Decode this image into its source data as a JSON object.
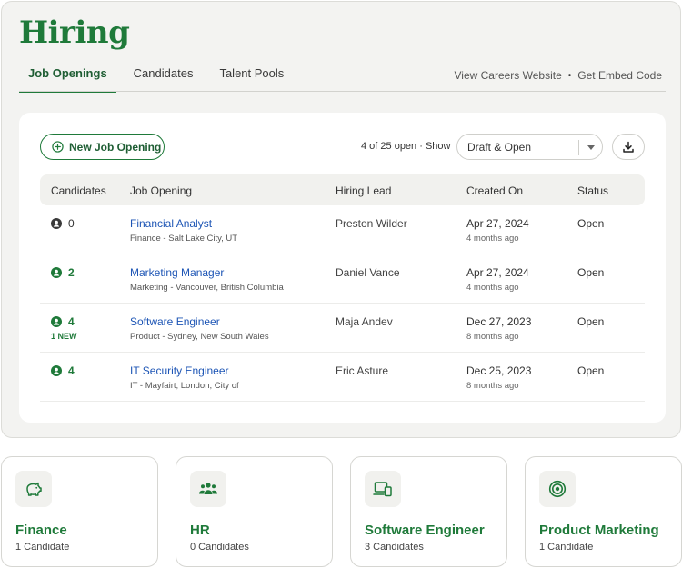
{
  "header": {
    "title": "Hiring"
  },
  "tabs": [
    {
      "label": "Job Openings",
      "active": true
    },
    {
      "label": "Candidates",
      "active": false
    },
    {
      "label": "Talent Pools",
      "active": false
    }
  ],
  "top_links": {
    "careers": "View Careers Website",
    "separator": "•",
    "embed": "Get Embed Code"
  },
  "toolbar": {
    "new_button": "New Job Opening",
    "open_count": "4 of 25 open · Show",
    "filter_value": "Draft & Open",
    "download_icon": "download-icon"
  },
  "table": {
    "columns": [
      "Candidates",
      "Job Opening",
      "Hiring Lead",
      "Created On",
      "Status"
    ],
    "rows": [
      {
        "candidates": "0",
        "new": "",
        "title": "Financial Analyst",
        "location": "Finance - Salt Lake City, UT",
        "lead": "Preston Wilder",
        "created": "Apr 27, 2024",
        "ago": "4 months ago",
        "status": "Open"
      },
      {
        "candidates": "2",
        "new": "",
        "title": "Marketing Manager",
        "location": "Marketing - Vancouver, British Columbia",
        "lead": "Daniel Vance",
        "created": "Apr 27, 2024",
        "ago": "4 months ago",
        "status": "Open"
      },
      {
        "candidates": "4",
        "new": "1 NEW",
        "title": "Software Engineer",
        "location": "Product - Sydney, New South Wales",
        "lead": "Maja Andev",
        "created": "Dec 27, 2023",
        "ago": "8 months ago",
        "status": "Open"
      },
      {
        "candidates": "4",
        "new": "",
        "title": "IT Security Engineer",
        "location": "IT - Mayfairt, London, City of",
        "lead": "Eric Asture",
        "created": "Dec 25, 2023",
        "ago": "8 months ago",
        "status": "Open"
      }
    ]
  },
  "pools": [
    {
      "name": "Finance",
      "count": "1 Candidate",
      "icon": "piggy-bank-icon"
    },
    {
      "name": "HR",
      "count": "0 Candidates",
      "icon": "people-icon"
    },
    {
      "name": "Software Engineer",
      "count": "3 Candidates",
      "icon": "devices-icon"
    },
    {
      "name": "Product Marketing",
      "count": "1 Candidate",
      "icon": "target-icon"
    }
  ],
  "colors": {
    "brand_green": "#1f7a3a",
    "link_blue": "#1d55b5",
    "panel_bg": "#f3f3f1"
  }
}
